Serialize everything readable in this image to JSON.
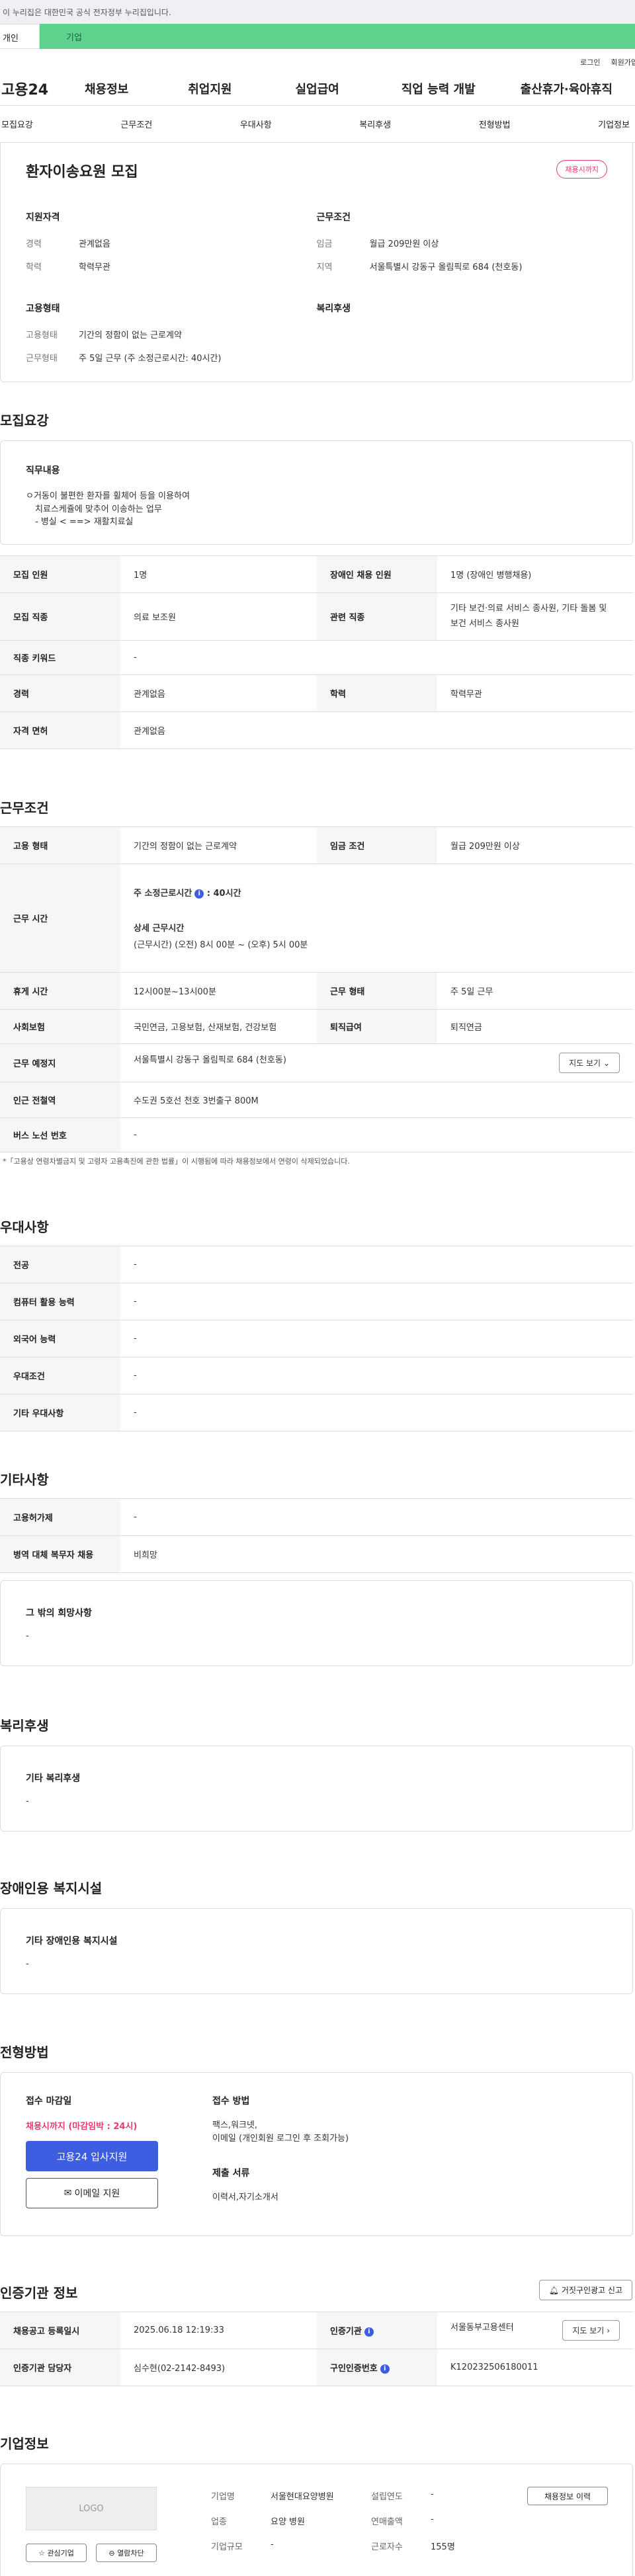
{
  "top": {
    "notice": "이 누리집은 대한민국 공식 전자정부 누리집입니다.",
    "tab_individual": "개인",
    "tab_company": "기업"
  },
  "util": {
    "login": "로그인",
    "join": "회원가입"
  },
  "gnb": {
    "logo": "고용24",
    "menu": [
      "채용정보",
      "취업지원",
      "실업급여",
      "직업 능력 개발",
      "출산휴가·육아휴직"
    ]
  },
  "subnav": [
    "모집요강",
    "근무조건",
    "우대사항",
    "복리후생",
    "전형방법",
    "기업정보"
  ],
  "summary": {
    "title": "환자이송요원 모집",
    "badge": "채용시까지",
    "qual_h": "지원자격",
    "career_k": "경력",
    "career_v": "관계없음",
    "edu_k": "학력",
    "edu_v": "학력무관",
    "emp_h": "고용형태",
    "emptype_k": "고용형태",
    "emptype_v": "기간의 정함이 없는 근로계약",
    "worktype_k": "근무형태",
    "worktype_v": "주 5일 근무 (주 소정근로시간: 40시간)",
    "cond_h": "근무조건",
    "wage_k": "임금",
    "wage_v": "월급 209만원 이상",
    "area_k": "지역",
    "area_v": "서울특별시 강동구 올림픽로 684 (천호동)",
    "welfare_h": "복리후생"
  },
  "recruit": {
    "title": "모집요강",
    "duty_h": "직무내용",
    "duty_l1": "ㅇ거동이 불편한 환자를 휠체어 등을 이용하여",
    "duty_l2": "치료스케쥴에 맞추어 이송하는 업무",
    "duty_l3": "- 병실 < ==> 재활치료실",
    "rows": {
      "count_k": "모집 인원",
      "count_v": "1명",
      "disabled_k": "장애인 채용 인원",
      "disabled_v": "1명 (장애인 병행채용)",
      "job_k": "모집 직종",
      "job_v": "의료 보조원",
      "related_k": "관련 직종",
      "related_v1": "기타 보건·의료 서비스 종사원, 기타 돌봄 및",
      "related_v2": "보건 서비스 종사원",
      "kw_k": "직종 키워드",
      "kw_v": "-",
      "career_k": "경력",
      "career_v": "관계없음",
      "edu_k": "학력",
      "edu_v": "학력무관",
      "lic_k": "자격 면허",
      "lic_v": "관계없음"
    }
  },
  "work": {
    "title": "근무조건",
    "emptype_k": "고용 형태",
    "emptype_v": "기간의 정함이 없는 근로계약",
    "wage_k": "임금 조건",
    "wage_v": "월급 209만원 이상",
    "hours_k": "근무 시간",
    "hours_l1": "주 소정근로시간",
    "hours_l1v": ": 40시간",
    "hours_l2": "상세 근무시간",
    "hours_l3": "(근무시간) (오전) 8시 00분 ~ (오후) 5시 00분",
    "rest_k": "휴게 시간",
    "rest_v": "12시00분~13시00분",
    "shape_k": "근무 형태",
    "shape_v": "주 5일 근무",
    "ins_k": "사회보험",
    "ins_v": "국민연금, 고용보험, 산재보험, 건강보험",
    "sev_k": "퇴직급여",
    "sev_v": "퇴직연금",
    "place_k": "근무 예정지",
    "place_v": "서울특별시 강동구 올림픽로 684 (천호동)",
    "map_btn": "지도 보기",
    "station_k": "인근 전철역",
    "station_v": "수도권 5호선 천호 3번출구 800M",
    "bus_k": "버스 노선 번호",
    "bus_v": "-",
    "note": "*「고용상 연령차별금지 및 고령자 고용촉진에 관한 법률」이 시행됨에 따라 채용정보에서 연령이 삭제되었습니다."
  },
  "pref": {
    "title": "우대사항",
    "major_k": "전공",
    "major_v": "-",
    "pc_k": "컴퓨터 활용 능력",
    "pc_v": "-",
    "lang_k": "외국어 능력",
    "lang_v": "-",
    "cond_k": "우대조건",
    "cond_v": "-",
    "etc_k": "기타 우대사항",
    "etc_v": "-"
  },
  "etc": {
    "title": "기타사항",
    "emp_k": "고용허가제",
    "emp_v": "-",
    "mil_k": "병역 대체 복무자 채용",
    "mil_v": "비희망",
    "wish_h": "그 밖의 희망사항",
    "wish_v": "-"
  },
  "welfare": {
    "title": "복리후생",
    "h": "기타 복리후생",
    "v": "-"
  },
  "facility": {
    "title": "장애인용 복지시설",
    "h": "기타 장애인용 복지시설",
    "v": "-"
  },
  "process": {
    "title": "전형방법",
    "deadline_h": "접수 마감일",
    "deadline_v": "채용시까지 (마감임박 : 24시)",
    "apply_btn": "고용24 입사지원",
    "email_btn": "이메일 지원",
    "method_h": "접수 방법",
    "method_l1": "팩스,워크넷,",
    "method_l2": "이메일 (개인회원 로그인 후 조회가능)",
    "docs_h": "제출 서류",
    "docs_v": "이력서,자기소개서"
  },
  "cert": {
    "title": "인증기관 정보",
    "report_btn": "거짓구인광고 신고",
    "reg_k": "채용공고 등록일시",
    "reg_v": "2025.06.18 12:19:33",
    "agency_k": "인증기관",
    "agency_v": "서울동부고용센터",
    "map_btn": "지도 보기",
    "mgr_k": "인증기관 담당자",
    "mgr_v": "심수현(02-2142-8493)",
    "num_k": "구인인증번호",
    "num_v": "K120232506180011"
  },
  "corp": {
    "title": "기업정보",
    "logo": "LOGO",
    "fav_btn": "관심기업",
    "block_btn": "열람차단",
    "history_btn": "채용정보 이력",
    "name_k": "기업명",
    "name_v": "서울현대요양병원",
    "year_k": "설립연도",
    "year_v": "-",
    "biz_k": "업종",
    "biz_v": "요양 병원",
    "sales_k": "연매출액",
    "sales_v": "-",
    "size_k": "기업규모",
    "size_v": "-",
    "emp_k": "근로자수",
    "emp_v": "155명"
  }
}
